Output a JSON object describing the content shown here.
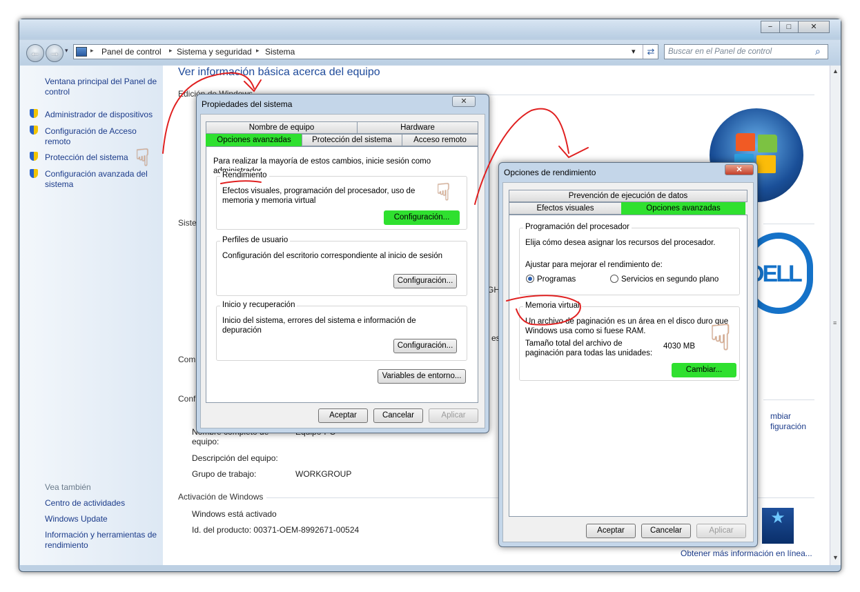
{
  "window": {
    "min_label": "−",
    "max_label": "□",
    "close_label": "✕",
    "back_icon": "←",
    "forward_icon": "→",
    "breadcrumbs": [
      "Panel de control",
      "Sistema y seguridad",
      "Sistema"
    ],
    "search_placeholder": "Buscar en el Panel de control"
  },
  "sidebar": {
    "home": "Ventana principal del Panel de control",
    "items": [
      "Administrador de dispositivos",
      "Configuración de Acceso remoto",
      "Protección del sistema",
      "Configuración avanzada del sistema"
    ],
    "see_also_title": "Vea también",
    "see_also": [
      "Centro de actividades",
      "Windows Update",
      "Información y herramientas de rendimiento"
    ]
  },
  "main": {
    "title": "Ver información básica acerca del equipo",
    "edition": "Edición de Windows",
    "partial": {
      "sistema": "Siste",
      "comp": "Com",
      "conf": "Conf",
      "gh": "GH",
      "es": "es",
      "cambiar": "mbiar",
      "configuracion": "figuración"
    },
    "full_name_label": "Nombre completo de equipo:",
    "full_name_value": "Equipo-PC",
    "description_label": "Descripción del equipo:",
    "workgroup_label": "Grupo de trabajo:",
    "workgroup_value": "WORKGROUP",
    "activation_title": "Activación de Windows",
    "activated": "Windows está activado",
    "product_id": "Id. del producto: 00371-OEM-8992671-00524",
    "more_info": "Obtener más información en línea..."
  },
  "sysprops": {
    "title": "Propiedades del sistema",
    "close_label": "✕",
    "tabs_top": [
      "Nombre de equipo",
      "Hardware"
    ],
    "tabs_bottom": [
      "Opciones avanzadas",
      "Protección del sistema",
      "Acceso remoto"
    ],
    "admin_note": "Para realizar la mayoría de estos cambios, inicie sesión como administrador.",
    "perf_title": "Rendimiento",
    "perf_desc": "Efectos visuales, programación del procesador, uso de memoria y memoria virtual",
    "profiles_title": "Perfiles de usuario",
    "profiles_desc": "Configuración del escritorio correspondiente al inicio de sesión",
    "startup_title": "Inicio y recuperación",
    "startup_desc": "Inicio del sistema, errores del sistema e información de depuración",
    "config_button": "Configuración...",
    "env_button": "Variables de entorno...",
    "ok": "Aceptar",
    "cancel": "Cancelar",
    "apply": "Aplicar"
  },
  "perfopts": {
    "title": "Opciones de rendimiento",
    "close_label": "✕",
    "tab_top": "Prevención de ejecución de datos",
    "tabs_bottom": [
      "Efectos visuales",
      "Opciones avanzadas"
    ],
    "cpu_title": "Programación del procesador",
    "cpu_desc": "Elija cómo desea asignar los recursos del procesador.",
    "adjust_label": "Ajustar para mejorar el rendimiento de:",
    "radio_programs": "Programas",
    "radio_services": "Servicios en segundo plano",
    "vm_title": "Memoria virtual",
    "vm_desc": "Un archivo de paginación es un área en el disco duro que Windows usa como si fuese RAM.",
    "vm_total_label": "Tamaño total del archivo de paginación para todas las unidades:",
    "vm_total_value": "4030 MB",
    "change_button": "Cambiar...",
    "ok": "Aceptar",
    "cancel": "Cancelar",
    "apply": "Aplicar"
  },
  "decor": {
    "dell_logo": "DELL",
    "hand_glyph": "☟",
    "search_glyph": "⌕",
    "refresh_glyph": "⇄",
    "chevron_glyph": "▾",
    "arrow_glyph": "▸",
    "star_glyph": "★"
  },
  "colors": {
    "highlight_green": "#2fe02f",
    "annotation_red": "#e02020",
    "link_blue": "#1b3b8a",
    "title_blue": "#1e4a9a"
  }
}
